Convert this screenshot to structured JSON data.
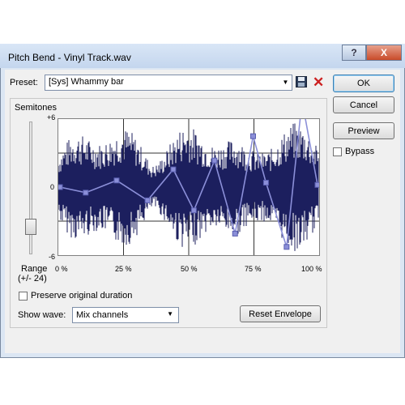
{
  "window": {
    "title": "Pitch Bend - Vinyl Track.wav",
    "help": "?",
    "close": "X"
  },
  "preset": {
    "label": "Preset:",
    "value": "[Sys] Whammy bar"
  },
  "buttons": {
    "ok": "OK",
    "cancel": "Cancel",
    "preview": "Preview",
    "reset": "Reset Envelope"
  },
  "bypass": {
    "label": "Bypass",
    "checked": false
  },
  "semitones": {
    "label": "Semitones",
    "range_line1": "Range",
    "range_line2": "(+/- 24)"
  },
  "y_ticks": [
    "+6",
    "0",
    "-6"
  ],
  "x_ticks": [
    "0 %",
    "25 %",
    "50 %",
    "75 %",
    "100 %"
  ],
  "preserve": {
    "label": "Preserve original duration",
    "checked": false
  },
  "show_wave": {
    "label": "Show wave:",
    "value": "Mix channels"
  },
  "envelope": {
    "y_range": [
      -6,
      6
    ],
    "points": [
      [
        0,
        0
      ],
      [
        10,
        -0.5
      ],
      [
        22,
        0.6
      ],
      [
        34,
        -1.2
      ],
      [
        44,
        1.6
      ],
      [
        52,
        -2.1
      ],
      [
        60,
        2.4
      ],
      [
        68,
        -4.2
      ],
      [
        75,
        4.6
      ],
      [
        80,
        0.4
      ],
      [
        88,
        -5.4
      ],
      [
        94,
        7.8
      ],
      [
        100,
        0.2
      ]
    ]
  },
  "colors": {
    "wave": "#1c1f5e",
    "envelope": "#8b8fd8",
    "accent": "#3c7fb1",
    "delete": "#cc2020"
  }
}
